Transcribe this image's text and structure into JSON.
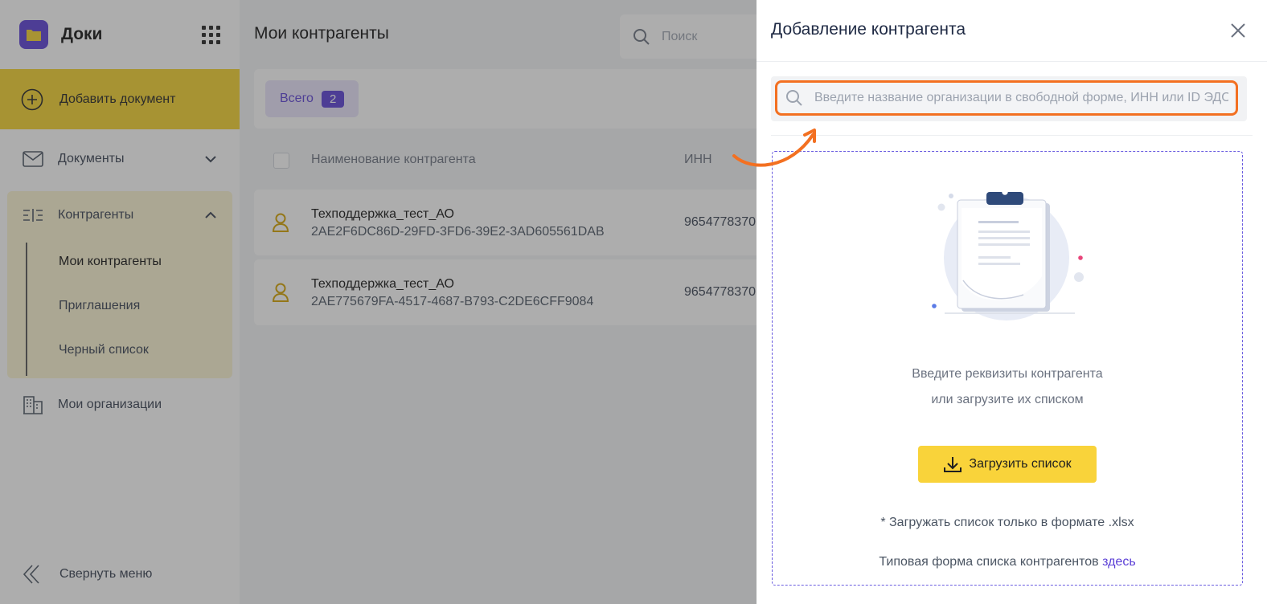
{
  "app": {
    "name": "Доки"
  },
  "sidebar": {
    "add_document": "Добавить документ",
    "documents": "Документы",
    "contractors": "Контрагенты",
    "sub_items": [
      "Мои контрагенты",
      "Приглашения",
      "Черный список"
    ],
    "my_orgs": "Мои организации",
    "collapse": "Свернуть меню"
  },
  "main": {
    "title": "Мои контрагенты",
    "search_placeholder": "Поиск",
    "filter": {
      "label": "Всего",
      "count": "2"
    },
    "columns": {
      "name": "Наименование контрагента",
      "inn": "ИНН"
    },
    "rows": [
      {
        "name": "Техподдержка_тест_АО",
        "id": "2AE2F6DC86D-29FD-3FD6-39E2-3AD605561DAB",
        "inn": "9654778370"
      },
      {
        "name": "Техподдержка_тест_АО",
        "id": "2AE775679FA-4517-4687-B793-C2DE6CFF9084",
        "inn": "9654778370"
      }
    ]
  },
  "drawer": {
    "title": "Добавление контрагента",
    "search_placeholder": "Введите название организации в свободной форме, ИНН или ID ЭДО",
    "hint_line1": "Введите реквизиты контрагента",
    "hint_line2": "или загрузите их списком",
    "upload_button": "Загрузить список",
    "note": "* Загружать список только в формате .xlsx",
    "template_text": "Типовая форма списка контрагентов ",
    "template_link": "здесь"
  },
  "colors": {
    "accent": "#5b3fd6",
    "yellow": "#f5d22e",
    "highlight": "#f37021"
  },
  "icons": [
    "folder-icon",
    "apps-grid-icon",
    "plus-circle-icon",
    "mail-icon",
    "chevron-down-icon",
    "contractors-icon",
    "chevron-up-icon",
    "building-icon",
    "collapse-icon",
    "search-icon",
    "user-icon",
    "close-icon",
    "download-icon",
    "clipboard-illustration"
  ]
}
